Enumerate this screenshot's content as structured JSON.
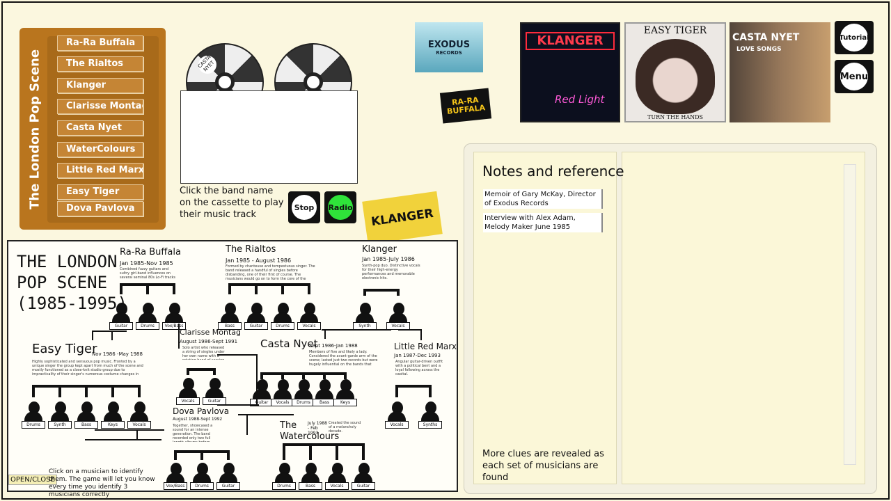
{
  "sidebar": {
    "title": "The London Pop Scene",
    "bands": [
      "Ra-Ra Buffala",
      "The Rialtos",
      "Klanger",
      "Clarisse Montag",
      "Casta Nyet",
      "WaterColours",
      "Little Red Marx",
      "Easy Tiger",
      "Dova Pavlova"
    ]
  },
  "cassette": {
    "reel_label": "CASTA NYET",
    "hint": "Click the band name on the cassette to play their music track",
    "stop_label": "Stop",
    "radio_label": "Radio"
  },
  "stickers": {
    "exodus_main": "EXODUS",
    "exodus_sub": "RECORDS",
    "rara": "RA-RA BUFFALA",
    "klanger": "KLANGER"
  },
  "albums": {
    "klanger_title": "KLANGER",
    "klanger_sub": "Red Light",
    "easy_title": "EASY TIGER",
    "easy_sub": "TURN THE HANDS",
    "casta_title": "CASTA NYET",
    "casta_sub": "LOVE SONGS"
  },
  "buttons": {
    "tutorial": "Tutorial",
    "menu": "Menu"
  },
  "notes": {
    "title": "Notes and reference",
    "items": [
      "Memoir of Gary McKay, Director of Exodus Records",
      "Interview with Alex Adam, Melody Maker June 1985"
    ],
    "footer": "More clues are revealed as each set of musicians are found"
  },
  "tree": {
    "title_line1": "THE LONDON",
    "title_line2": "POP SCENE",
    "title_line3": "(1985-1995)",
    "bands": {
      "rara": {
        "name": "Ra-Ra Buffala",
        "date": "Jan 1985-Nov 1985",
        "desc": "Combined fuzzy guitars and sultry girl-band influences on several seminal 80s Lo-Fi tracks"
      },
      "rialtos": {
        "name": "The Rialtos",
        "date": "Jan 1985 - August 1986",
        "desc": "Formed by chanteuse and tempestuous singer. The band released a handful of singles before disbanding, one of their first of course. The musicians would go on to form the core of the London scene."
      },
      "klanger": {
        "name": "Klanger",
        "date": "Jan 1985-July 1986",
        "desc": "Synth-pop duo. Distinctive vocals for their high-energy performances and memorable electronic hits."
      },
      "clarisse": {
        "name": "Clarisse Montag",
        "date": "August 1986-Sept 1991",
        "desc": "Solo artist who released a string of singles under her own name with a rotating band of session players."
      },
      "easy": {
        "name": "Easy Tiger",
        "date": "Nov 1986 -May 1988",
        "desc": "Highly sophisticated and sensuous pop music. Fronted by a unique singer the group kept apart from much of the scene and mostly functioned as a close-knit studio group due to impracticality of their singer's numerous costume changes in shows and the exhaustion this caused."
      },
      "casta": {
        "name": "Casta Nyet",
        "date": "Sept 1986-Jan 1988",
        "desc": "Members of five and likely a lady. Considered the avant-garde arm of the scene; lasted just two records but were hugely influential on the bands that followed."
      },
      "marx": {
        "name": "Little Red Marx",
        "date": "Jan 1987-Dec 1993",
        "desc": "Angular guitar-driven outfit with a political bent and a loyal following across the capital."
      },
      "dova": {
        "name": "Dova Pavlova",
        "date": "August 1988-Sept 1992",
        "desc": "Together, showcased a sound for an intense generation. The band recorded only two full length albums before splitting."
      },
      "water": {
        "name1": "The",
        "name2": "Watercolours",
        "date": "July 1988 - Feb 1993",
        "desc": "Created the sound of a melancholy decade."
      }
    },
    "roles": {
      "rara": [
        "Guitar",
        "Drums",
        "Vox/Bass"
      ],
      "rialtos": [
        "Bass",
        "Guitar",
        "Drums",
        "Vocals"
      ],
      "klanger": [
        "Synth",
        "Vocals"
      ],
      "clarisse": [
        "Vocals",
        "Guitar"
      ],
      "easy": [
        "Drums",
        "Synth",
        "Bass",
        "Keys",
        "Vocals"
      ],
      "casta": [
        "Guitar",
        "Vocals",
        "Drums",
        "Bass",
        "Keys"
      ],
      "marx": [
        "Vocals",
        "Synths"
      ],
      "dova": [
        "Vox/Bass",
        "Drums",
        "Guitar"
      ],
      "water": [
        "Drums",
        "Bass",
        "Vocals",
        "Guitar"
      ]
    },
    "open_close": "OPEN/CLOSE",
    "hint": "Click on a musician to identify them. The game will let you know every time you identify 3 musicians correctly"
  }
}
